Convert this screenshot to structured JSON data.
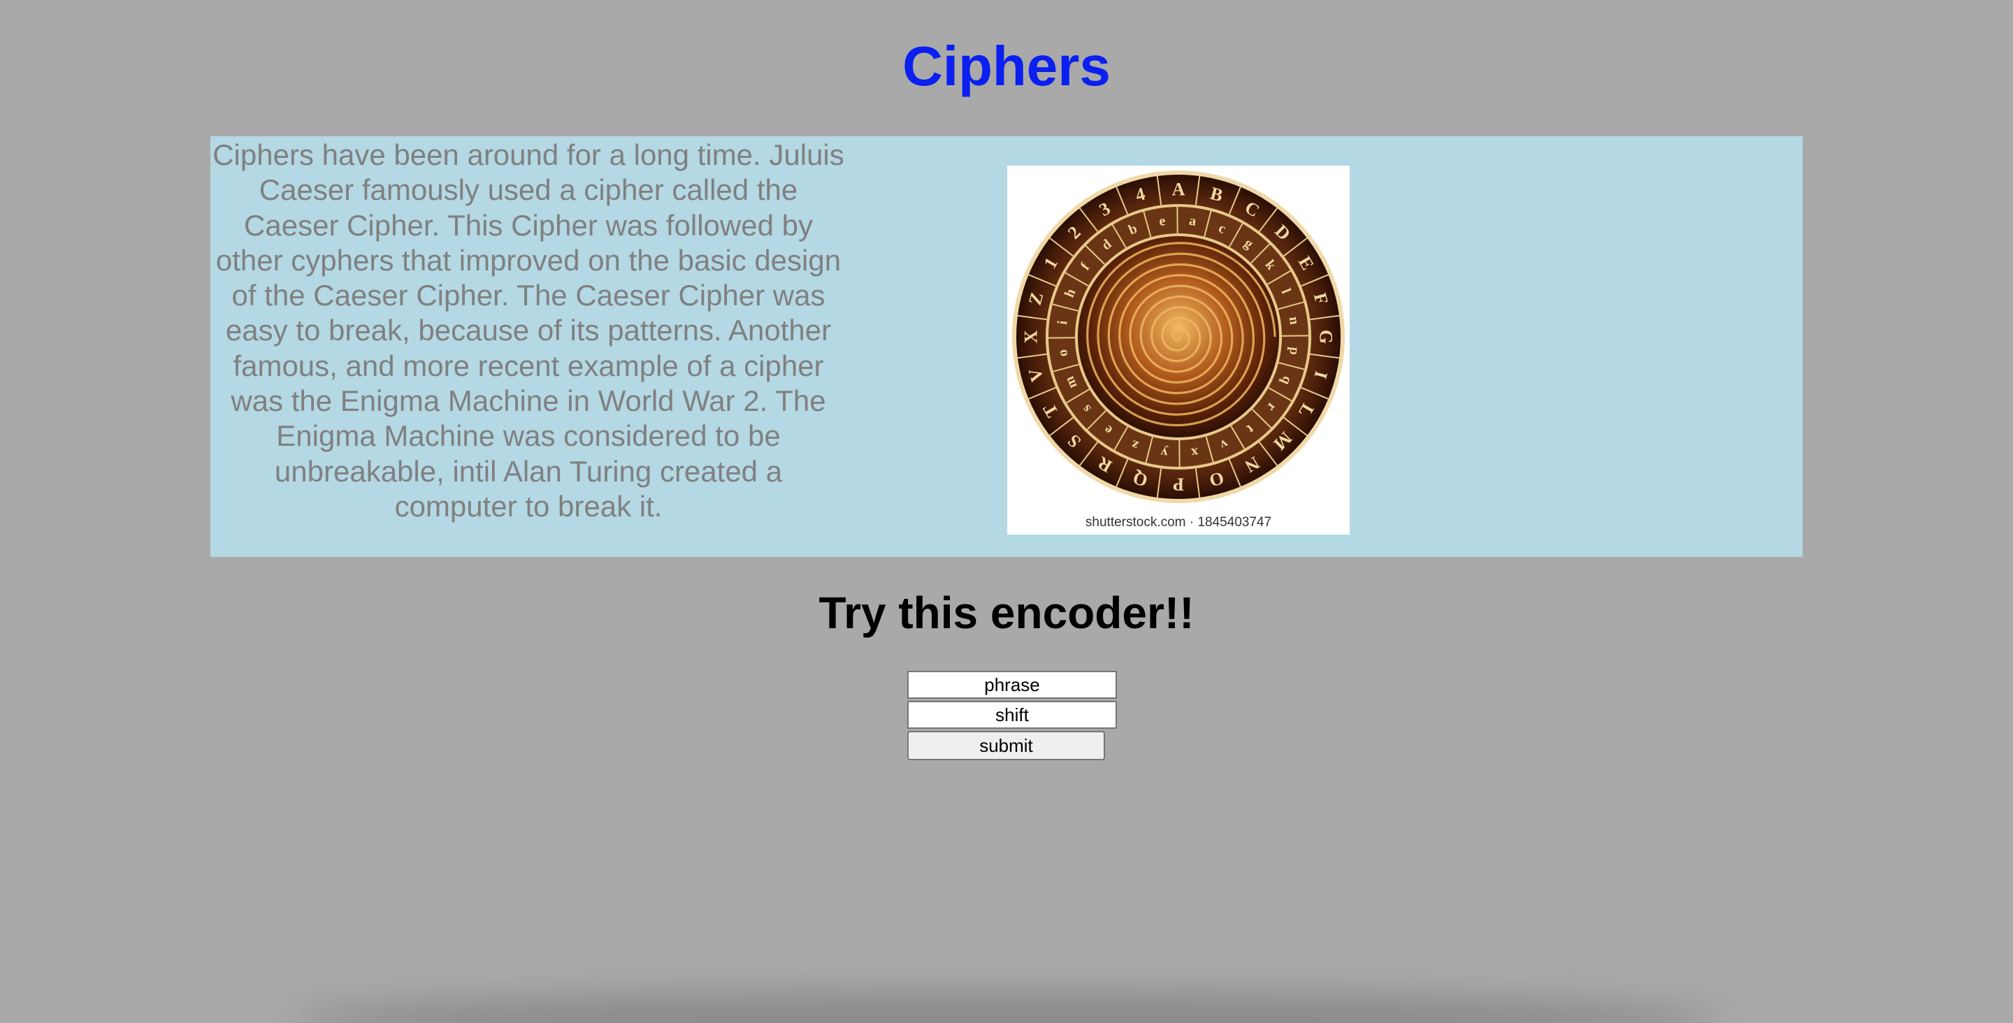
{
  "header": {
    "title": "Ciphers"
  },
  "intro": {
    "text": "Ciphers have been around for a long time. Juluis Caeser famously used a cipher called the Caeser Cipher. This Cipher was followed by other cyphers that improved on the basic design of the Caeser Cipher. The Caeser Cipher was easy to break, because of its patterns. Another famous, and more recent example of a cipher was the Enigma Machine in World War 2. The Enigma Machine was considered to be unbreakable, intil Alan Turing created a computer to break it."
  },
  "image": {
    "icon": "cipher-wheel-image",
    "watermark": "shutterstock.com · 1845403747",
    "outer_letters": [
      "A",
      "B",
      "C",
      "D",
      "E",
      "F",
      "G",
      "I",
      "L",
      "M",
      "N",
      "O",
      "P",
      "Q",
      "R",
      "S",
      "T",
      "V",
      "X",
      "Z",
      "1",
      "2",
      "3",
      "4"
    ],
    "inner_letters": [
      "a",
      "c",
      "g",
      "k",
      "l",
      "n",
      "p",
      "q",
      "r",
      "t",
      "v",
      "x",
      "y",
      "z",
      "e",
      "s",
      "m",
      "o",
      "i",
      "h",
      "f",
      "d",
      "b",
      "e"
    ],
    "colors": {
      "outer_ring": "#5a2610",
      "inner_ring": "#6a3514",
      "spiral_dark": "#3d1608",
      "spiral_light": "#e0a24a",
      "letter": "#f3d9a0"
    }
  },
  "encoder": {
    "heading": "Try this encoder!!",
    "phrase_placeholder": "phrase",
    "shift_placeholder": "shift",
    "submit_label": "submit"
  },
  "colors": {
    "page_bg": "#a9a9a9",
    "title": "#0a1ff0",
    "content_bg": "#b4d8e4",
    "intro_text": "#808080"
  }
}
